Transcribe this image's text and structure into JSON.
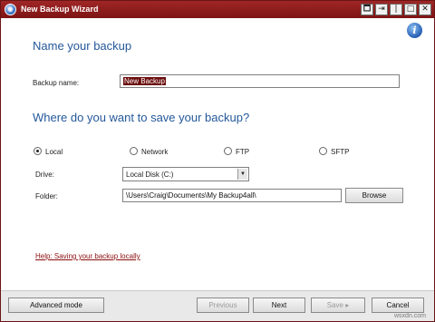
{
  "window": {
    "title": "New Backup Wizard",
    "titlebar_buttons": [
      "🗖",
      "⇥",
      "|",
      "□",
      "✕"
    ],
    "accent_color": "#8b1a1a"
  },
  "help": {
    "icon": "info-icon"
  },
  "section1": {
    "heading": "Name your backup",
    "backup_name_label": "Backup name:",
    "backup_name_value": "New Backup"
  },
  "section2": {
    "heading": "Where do you want to save your backup?",
    "options": [
      {
        "label": "Local",
        "selected": true
      },
      {
        "label": "Network",
        "selected": false
      },
      {
        "label": "FTP",
        "selected": false
      },
      {
        "label": "SFTP",
        "selected": false
      }
    ],
    "drive_label": "Drive:",
    "drive_value": "Local Disk (C:)",
    "folder_label": "Folder:",
    "folder_value": "\\Users\\Craig\\Documents\\My Backup4all\\",
    "browse_label": "Browse"
  },
  "help_link": "Help: Saving your backup locally",
  "footer": {
    "advanced": "Advanced mode",
    "previous": "Previous",
    "next": "Next",
    "save": "Save",
    "save_arrow": "▸",
    "cancel": "Cancel"
  },
  "watermark": "wsxdn.com"
}
